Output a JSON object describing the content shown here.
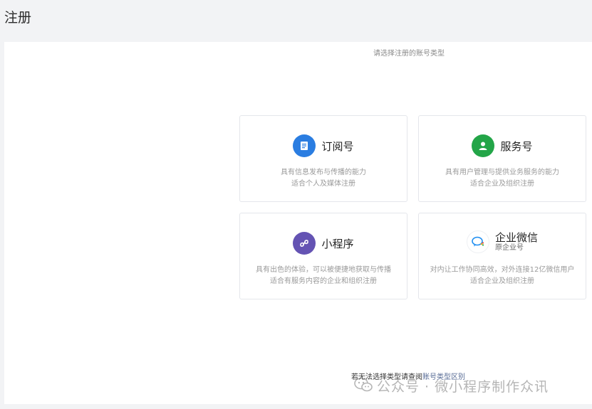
{
  "page": {
    "title": "注册"
  },
  "prompt": "请选择注册的账号类型",
  "cards": [
    {
      "id": "subscription",
      "title": "订阅号",
      "subtitle": "",
      "icon": "document-icon",
      "icon_color": "#2a7de1",
      "desc_line1": "具有信息发布与传播的能力",
      "desc_line2": "适合个人及媒体注册"
    },
    {
      "id": "service",
      "title": "服务号",
      "subtitle": "",
      "icon": "user-icon",
      "icon_color": "#23a548",
      "desc_line1": "具有用户管理与提供业务服务的能力",
      "desc_line2": "适合企业及组织注册"
    },
    {
      "id": "miniprogram",
      "title": "小程序",
      "subtitle": "",
      "icon": "miniprogram-icon",
      "icon_color": "#6453b3",
      "desc_line1": "具有出色的体验，可以被便捷地获取与传播",
      "desc_line2": "适合有服务内容的企业和组织注册"
    },
    {
      "id": "wecom",
      "title": "企业微信",
      "subtitle": "原企业号",
      "icon": "wecom-icon",
      "icon_color": "#1f8ef1",
      "desc_line1": "对内让工作协同高效，对外连接12亿微信用户",
      "desc_line2": "适合企业及组织注册"
    }
  ],
  "bottom": {
    "text": "若无法选择类型请查阅",
    "link": "账号类型区别"
  },
  "watermark": {
    "text": "公众号 · 微小程序制作众讯",
    "icon": "wechat-icon"
  }
}
